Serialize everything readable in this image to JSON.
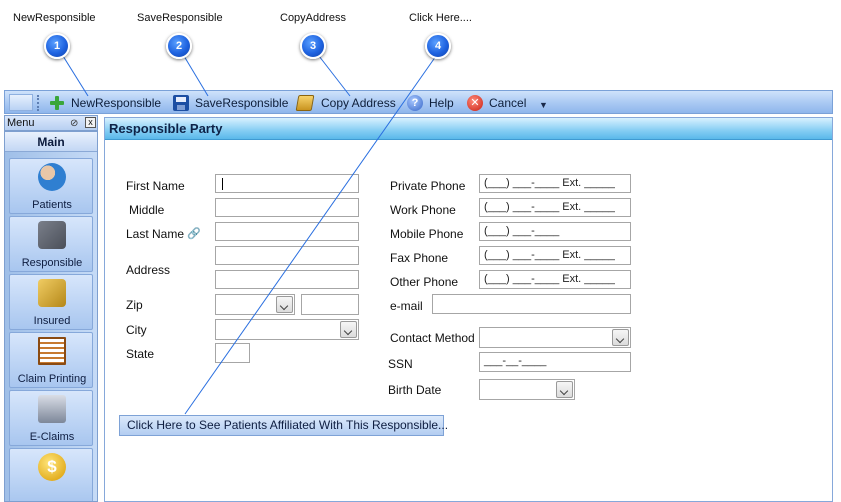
{
  "callouts": [
    {
      "number": "1",
      "label": "NewResponsible"
    },
    {
      "number": "2",
      "label": "SaveResponsible"
    },
    {
      "number": "3",
      "label": "CopyAddress"
    },
    {
      "number": "4",
      "label": "Click Here...."
    }
  ],
  "toolbar": {
    "new_label": "NewResponsible",
    "save_label": "SaveResponsible",
    "copy_label": "Copy Address",
    "help_label": "Help",
    "cancel_label": "Cancel",
    "help_glyph": "?",
    "cancel_glyph": "✕",
    "overflow_glyph": "▼"
  },
  "menu": {
    "header": "Menu",
    "close_glyph": "x",
    "section": "Main",
    "items": [
      {
        "label": "Patients",
        "icon": "patients-icon"
      },
      {
        "label": "Responsible",
        "icon": "book-icon"
      },
      {
        "label": "Insured",
        "icon": "gold-book-icon"
      },
      {
        "label": "Claim Printing",
        "icon": "claim-icon"
      },
      {
        "label": "E-Claims",
        "icon": "eclaims-icon"
      }
    ],
    "dollar_glyph": "$"
  },
  "form": {
    "title": "Responsible Party",
    "first_name_label": "First Name",
    "middle_label": "Middle",
    "last_name_label": "Last Name",
    "address_label": "Address",
    "zip_label": "Zip",
    "city_label": "City",
    "state_label": "State",
    "private_phone_label": "Private Phone",
    "work_phone_label": "Work Phone",
    "mobile_phone_label": "Mobile Phone",
    "fax_phone_label": "Fax Phone",
    "other_phone_label": "Other Phone",
    "email_label": "e-mail",
    "contact_method_label": "Contact Method",
    "ssn_label": "SSN",
    "birth_date_label": "Birth Date",
    "phone_mask_ext": "(___) ___-____ Ext. _____",
    "phone_mask": "(___) ___-____",
    "ssn_mask": "___-__-____",
    "patients_button": "Click Here to See Patients Affiliated With This Responsible..."
  }
}
